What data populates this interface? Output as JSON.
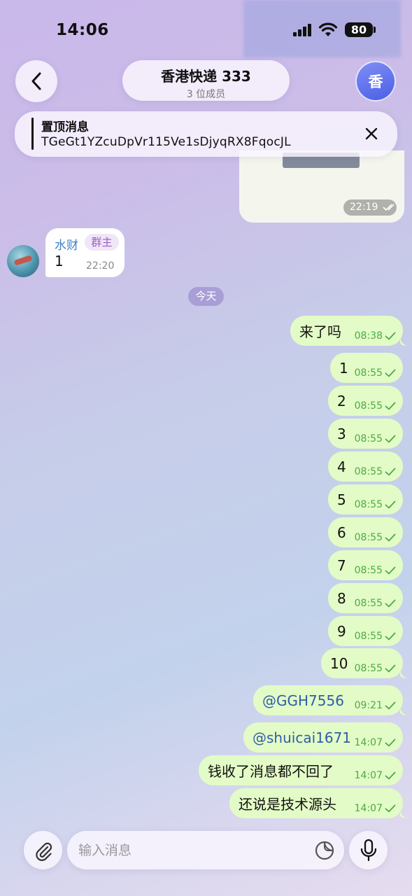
{
  "status_bar": {
    "time": "14:06",
    "battery": "80"
  },
  "header": {
    "title": "香港快递 333",
    "subtitle": "3 位成员",
    "avatar_letter": "香"
  },
  "pinned": {
    "label": "置顶消息",
    "text": "TGeGt1YZcuDpVr115Ve1sDjyqRX8FqocJL"
  },
  "earlier_message": {
    "time": "22:19"
  },
  "incoming_message": {
    "sender": "水财",
    "role_badge": "群主",
    "text": "1",
    "time": "22:20"
  },
  "date_divider": "今天",
  "outgoing_messages": [
    {
      "text": "来了吗",
      "time": "08:38"
    },
    {
      "text": "1",
      "time": "08:55"
    },
    {
      "text": "2",
      "time": "08:55"
    },
    {
      "text": "3",
      "time": "08:55"
    },
    {
      "text": "4",
      "time": "08:55"
    },
    {
      "text": "5",
      "time": "08:55"
    },
    {
      "text": "6",
      "time": "08:55"
    },
    {
      "text": "7",
      "time": "08:55"
    },
    {
      "text": "8",
      "time": "08:55"
    },
    {
      "text": "9",
      "time": "08:55"
    },
    {
      "text": "10",
      "time": "08:55"
    },
    {
      "text": "@GGH7556",
      "time": "09:21"
    },
    {
      "text": "@shuicai1671",
      "time": "14:07"
    },
    {
      "text": "钱收了消息都不回了",
      "time": "14:07"
    },
    {
      "text": "还说是技术源头",
      "time": "14:07"
    }
  ],
  "composer": {
    "placeholder": "输入消息"
  },
  "colors": {
    "outgoing_bubble": "#e3fbc6",
    "check_green": "#4caa47",
    "mention_blue": "#2d5fa6",
    "sender_name": "#3d82c4"
  }
}
